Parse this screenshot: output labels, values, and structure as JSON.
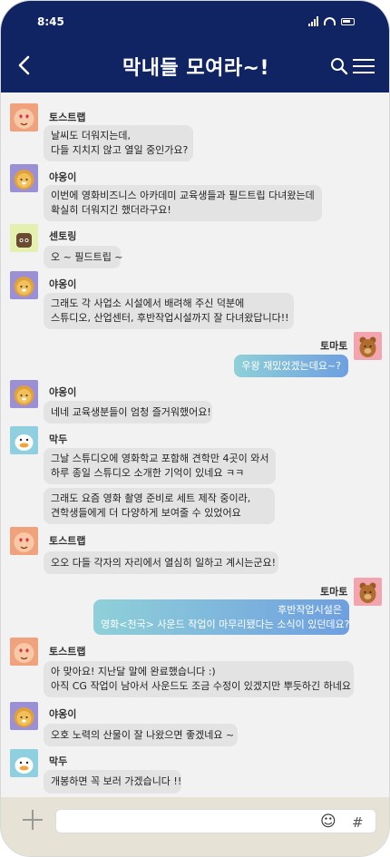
{
  "status_bar": {
    "time": "8:45"
  },
  "header": {
    "title": "막내들 모여라~!"
  },
  "colors": {
    "header_bg": "#102463",
    "my_bubble_gradient": [
      "#8fd0d8",
      "#6e9fe0"
    ],
    "other_bubble": "#e3e3e3",
    "footer_bg": "#e6e2d6"
  },
  "icons": {
    "back": "chevron-left-icon",
    "search": "search-icon",
    "menu": "hamburger-menu-icon",
    "attach": "plus-icon",
    "emoji": "smiley-icon",
    "hash": "hash-icon"
  },
  "icon_glyphs": {
    "emoji": "☺",
    "hash": "#"
  },
  "messages": [
    {
      "sender": "토스트랩",
      "text": [
        "날씨도 더워지는데,",
        "다들 지치지 않고 열일 중인가요?"
      ]
    },
    {
      "sender": "야옹이",
      "text": [
        "이번에 영화비즈니스 아카데미 교육생들과 필드트립 다녀왔는데",
        "확실히 더워지긴 했더라구요!"
      ]
    },
    {
      "sender": "센토링",
      "text": [
        "오 ~ 필드트립 ~"
      ]
    },
    {
      "sender": "야옹이",
      "text": [
        "그래도 각 사업소 시설에서 배려해 주신 덕분에",
        "스튜디오, 산업센터, 후반작업시설까지 잘 다녀왔답니다!!"
      ]
    },
    {
      "sender": "토마토",
      "text": [
        "우왕 재밌었겠는데요~?"
      ]
    },
    {
      "sender": "야옹이",
      "text": [
        "네네 교육생분들이 엄청 즐거워했어요!"
      ]
    },
    {
      "sender": "막두",
      "text": [
        "그날 스튜디오에 영화학교 포함해 견학만 4곳이 와서",
        "하루 종일 스튜디오 소개한 기억이 있네요 ㅋㅋ"
      ]
    },
    {
      "sender": "막두",
      "text": [
        "그래도 요즘 영화 촬영 준비로 세트 제작 중이라,",
        "견학생들에게 더 다양하게 보여줄 수 있었어요"
      ]
    },
    {
      "sender": "토스트랩",
      "text": [
        "오오 다들 각자의 자리에서 열심히 일하고 계시는군요!"
      ]
    },
    {
      "sender": "토마토",
      "text": [
        "후반작업시설은",
        "영화<천국> 사운드 작업이 마무리됐다는 소식이 있던데요?"
      ]
    },
    {
      "sender": "토스트랩",
      "text": [
        "아 맞아요! 지난달 말에 완료했습니다 :)",
        "아직 CG 작업이 남아서 사운드도 조금 수정이 있겠지만 뿌듯하긴 하네요"
      ]
    },
    {
      "sender": "야옹이",
      "text": [
        "오호 노력의 산물이 잘 나왔으면 좋겠네요 ~"
      ]
    },
    {
      "sender": "막두",
      "text": [
        "개봉하면 꼭 보러 가겠습니다 !!"
      ]
    }
  ]
}
